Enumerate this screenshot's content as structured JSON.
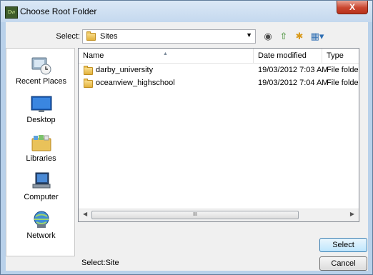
{
  "window": {
    "title": "Choose Root Folder",
    "app_icon_text": "Dw",
    "close_glyph": "X"
  },
  "lookin": {
    "label": "Select:",
    "value": "Sites",
    "arrow": "▼"
  },
  "toolbar": {
    "back_icon": "◉",
    "up_icon": "⇧",
    "new_folder_icon": "✱",
    "views_icon": "▦▾"
  },
  "places": [
    {
      "label": "Recent Places",
      "icon": "recent-places-icon"
    },
    {
      "label": "Desktop",
      "icon": "desktop-icon"
    },
    {
      "label": "Libraries",
      "icon": "libraries-icon"
    },
    {
      "label": "Computer",
      "icon": "computer-icon"
    },
    {
      "label": "Network",
      "icon": "network-icon"
    }
  ],
  "columns": {
    "name": "Name",
    "date": "Date modified",
    "type": "Type"
  },
  "files": [
    {
      "name": "darby_university",
      "date": "19/03/2012 7:03 AM",
      "type": "File folder"
    },
    {
      "name": "oceanview_highschool",
      "date": "19/03/2012 7:04 AM",
      "type": "File folder"
    }
  ],
  "scrollbar": {
    "left": "◀",
    "right": "▶",
    "grip": "III"
  },
  "footer": {
    "selection_label": "Select:Site",
    "select_button": "Select",
    "cancel_button": "Cancel"
  },
  "colors": {
    "frame": "#b9d1ea",
    "close": "#c9452f",
    "folder": "#e2b23d"
  }
}
